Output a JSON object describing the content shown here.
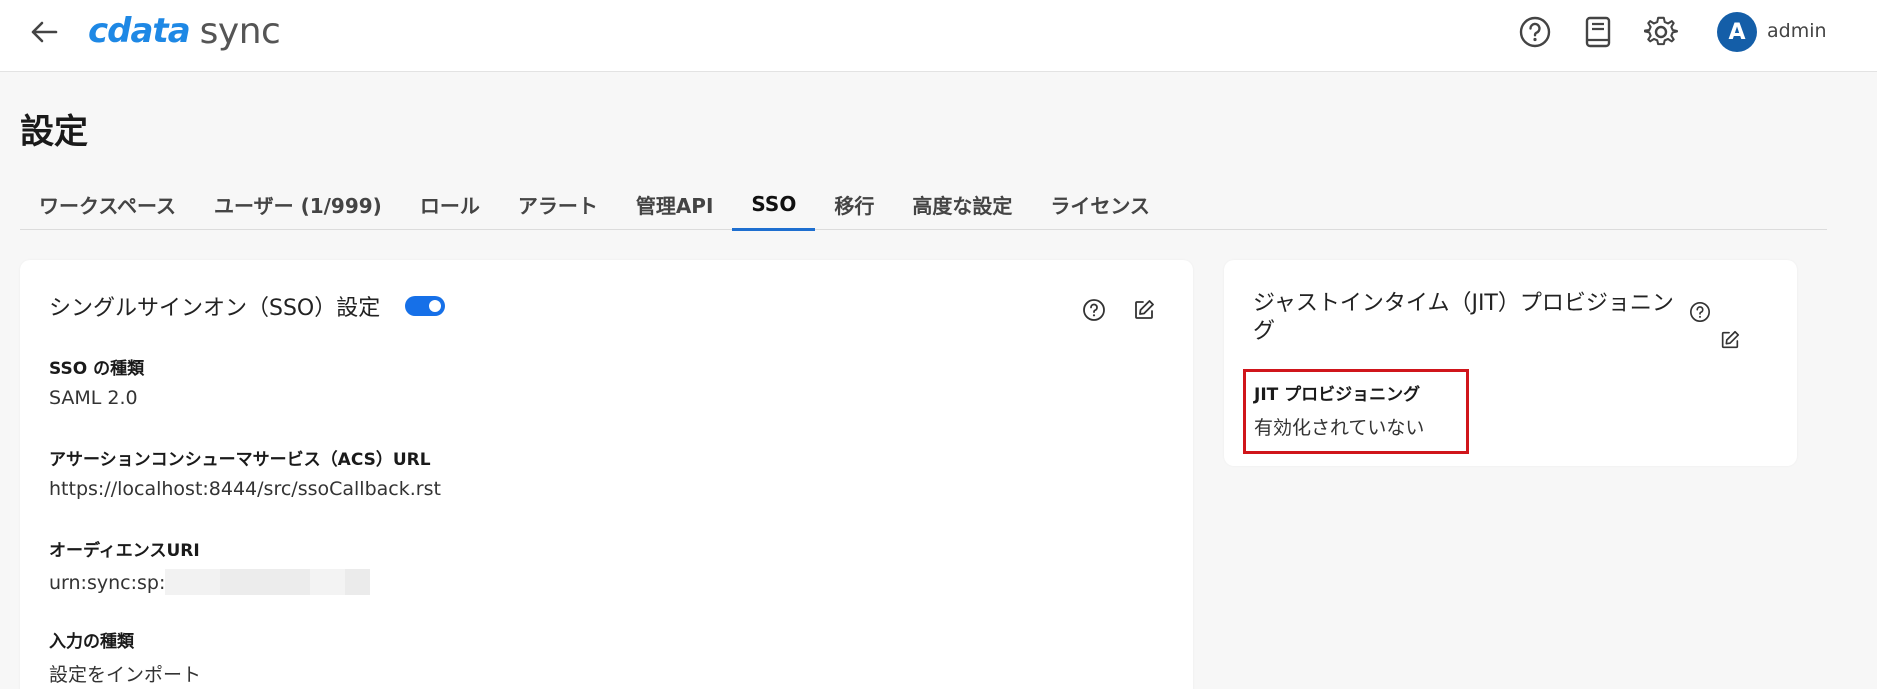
{
  "header": {
    "logo_brand": "cdata",
    "logo_product": "sync",
    "avatar_initial": "A",
    "username": "admin"
  },
  "page": {
    "title": "設定"
  },
  "tabs": [
    {
      "label": "ワークスペース"
    },
    {
      "label": "ユーザー (1/999)"
    },
    {
      "label": "ロール"
    },
    {
      "label": "アラート"
    },
    {
      "label": "管理API"
    },
    {
      "label": "SSO"
    },
    {
      "label": "移行"
    },
    {
      "label": "高度な設定"
    },
    {
      "label": "ライセンス"
    }
  ],
  "active_tab": "SSO",
  "sso_card": {
    "title": "シングルサインオン（SSO）設定",
    "enabled": true,
    "fields": [
      {
        "label": "SSO の種類",
        "value": "SAML 2.0"
      },
      {
        "label": "アサーションコンシューマサービス（ACS）URL",
        "value": "https://localhost:8444/src/ssoCallback.rst"
      },
      {
        "label": "オーディエンスURI",
        "value": "urn:sync:sp:"
      },
      {
        "label": "入力の種類",
        "value": "設定をインポート"
      }
    ]
  },
  "jit_card": {
    "title_line1": "ジャストインタイム（JIT）プロビジョニン",
    "title_line2": "グ",
    "field_label": "JIT プロビジョニング",
    "field_value": "有効化されていない"
  },
  "colors": {
    "accent": "#1e6fd0",
    "brand": "#1e88e5",
    "highlight": "#d0151b",
    "avatar": "#145ea8"
  }
}
